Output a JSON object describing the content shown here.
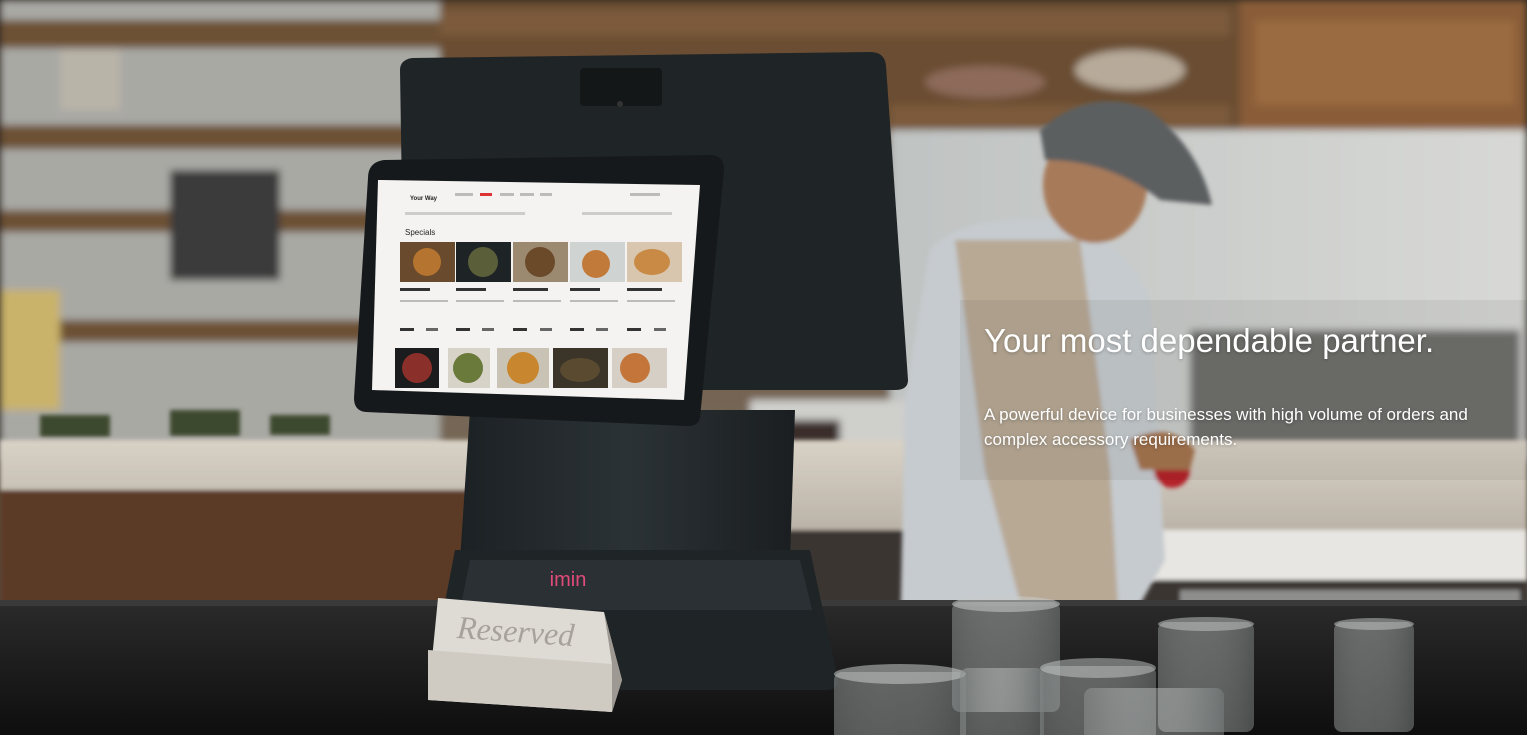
{
  "hero": {
    "headline": "Your most dependable partner.",
    "subtext": "A powerful device for businesses with high volume of orders and complex accessory requirements."
  },
  "device": {
    "brand": "imin",
    "screen": {
      "logo": "Your Way",
      "section_title": "Specials"
    }
  },
  "table_sign": "Reserved"
}
